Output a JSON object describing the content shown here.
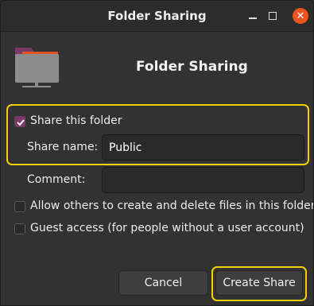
{
  "window": {
    "title": "Folder Sharing",
    "minimize_icon": "minimize-icon",
    "maximize_icon": "maximize-icon",
    "close_icon": "close-icon"
  },
  "header": {
    "icon": "folder-network-icon",
    "title": "Folder Sharing"
  },
  "share_this_folder": {
    "label": "Share this folder",
    "checked": true
  },
  "share_name": {
    "label": "Share name:",
    "value": "Public"
  },
  "comment": {
    "label": "Comment:",
    "value": ""
  },
  "allow_others": {
    "label": "Allow others to create and delete files in this folder",
    "checked": false
  },
  "guest_access": {
    "label": "Guest access (for people without a user account)",
    "checked": false
  },
  "buttons": {
    "cancel": "Cancel",
    "create_share": "Create Share"
  },
  "colors": {
    "accent": "#7b3a66",
    "close": "#e95420",
    "highlight": "#f5d000"
  }
}
